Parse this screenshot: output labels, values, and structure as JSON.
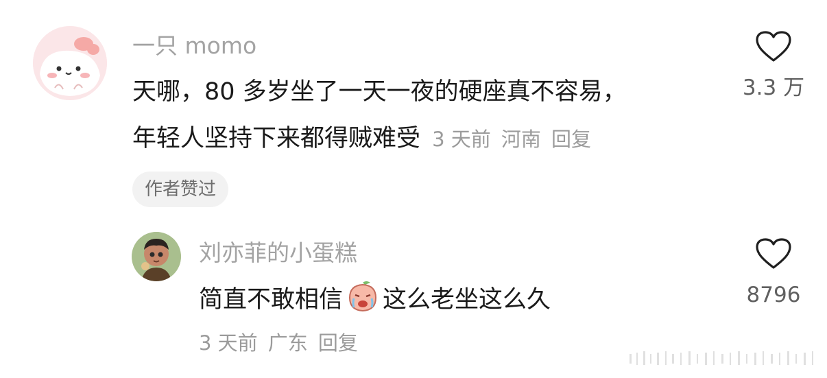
{
  "comments": [
    {
      "username": "一只 momo",
      "text_line1": "天哪，80 多岁坐了一天一夜的硬座真不容易，",
      "text_line2": "年轻人坚持下来都得贼难受",
      "time": "3 天前",
      "location": "河南",
      "reply_label": "回复",
      "likes": "3.3 万",
      "badge": "作者赞过",
      "avatar_icon": "pink-bunny-avatar"
    },
    {
      "username": "刘亦菲的小蛋糕",
      "text_before_emoji": "简直不敢相信",
      "emoji_icon": "crying-peach-emoji",
      "text_after_emoji": "这么老坐这么久",
      "time": "3 天前",
      "location": "广东",
      "reply_label": "回复",
      "likes": "8796",
      "avatar_icon": "cartoon-boy-avatar"
    }
  ],
  "colors": {
    "username": "#a3a3a3",
    "text": "#1a1a1a",
    "meta": "#9b9b9b",
    "badge_bg": "#f2f2f2"
  }
}
